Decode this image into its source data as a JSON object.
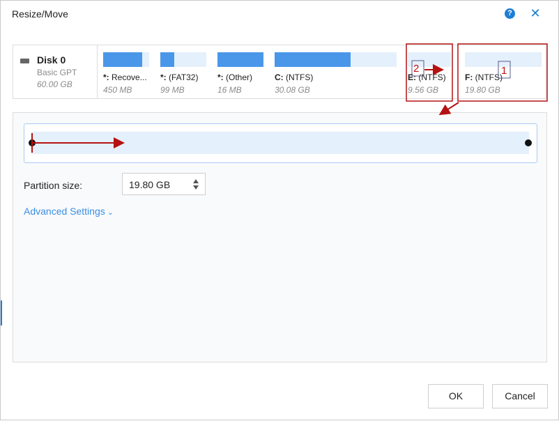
{
  "window": {
    "title": "Resize/Move",
    "help_icon": "?",
    "close_icon": "✕"
  },
  "disk": {
    "name": "Disk 0",
    "type": "Basic GPT",
    "size": "60.00 GB"
  },
  "partitions": [
    {
      "letter": "*:",
      "fs": "Recove...",
      "size": "450 MB",
      "used_fraction": 0.85
    },
    {
      "letter": "*:",
      "fs": "(FAT32)",
      "size": "99 MB",
      "used_fraction": 0.3
    },
    {
      "letter": "*:",
      "fs": "(Other)",
      "size": "16 MB",
      "used_fraction": 1.0
    },
    {
      "letter": "C:",
      "fs": "(NTFS)",
      "size": "30.08 GB",
      "used_fraction": 0.62
    },
    {
      "letter": "E:",
      "fs": "(NTFS)",
      "size": "9.56 GB",
      "used_fraction": 0.0
    },
    {
      "letter": "F:",
      "fs": "(NTFS)",
      "size": "19.80 GB",
      "used_fraction": 0.0
    }
  ],
  "resize": {
    "partition_size_label": "Partition size:",
    "partition_size_value": "19.80 GB",
    "advanced_settings": "Advanced Settings",
    "chevron_icon": "⌄"
  },
  "buttons": {
    "ok": "OK",
    "cancel": "Cancel"
  },
  "annotations": {
    "step1": "1",
    "step2": "2",
    "color": "#c41010"
  },
  "colors": {
    "accent": "#1c7ed6",
    "partition_fill": "#4a97ea",
    "partition_free": "#e4f0fb",
    "link": "#3a8ee6"
  }
}
